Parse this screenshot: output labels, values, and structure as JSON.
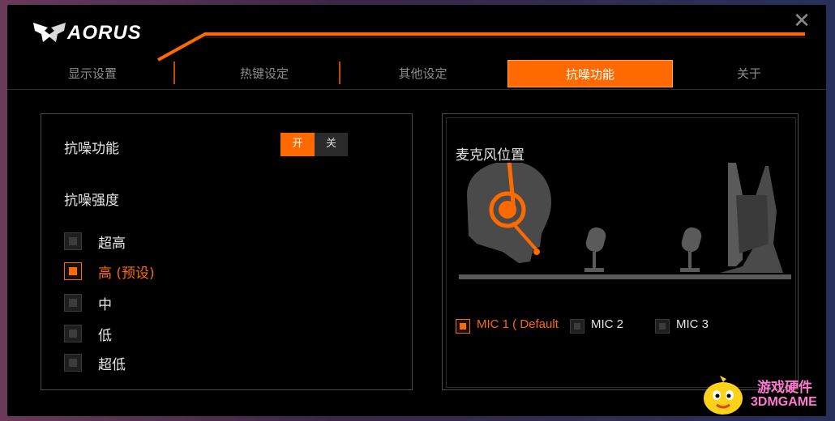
{
  "app": {
    "brand": "AORUS",
    "close_glyph": "✕"
  },
  "tabs": [
    {
      "label": "显示设置",
      "active": false
    },
    {
      "label": "热键设定",
      "active": false
    },
    {
      "label": "其他设定",
      "active": false
    },
    {
      "label": "抗噪功能",
      "active": true
    },
    {
      "label": "关于",
      "active": false
    }
  ],
  "noise_panel": {
    "feature_label": "抗噪功能",
    "toggle_on_label": "开",
    "toggle_off_label": "关",
    "toggle_state": "on",
    "strength_label": "抗噪强度",
    "options": [
      {
        "label": "超高",
        "checked": false
      },
      {
        "label": "高 (预设)",
        "checked": true
      },
      {
        "label": "中",
        "checked": false
      },
      {
        "label": "低",
        "checked": false
      },
      {
        "label": "超低",
        "checked": false
      }
    ]
  },
  "mic_panel": {
    "title": "麦克风位置",
    "options": [
      {
        "label": "MIC 1 ( Default",
        "checked": true
      },
      {
        "label": "MIC 2",
        "checked": false
      },
      {
        "label": "MIC 3",
        "checked": false
      }
    ]
  },
  "watermark": {
    "line1": "游戏硬件",
    "line2": "3DMGAME"
  },
  "colors": {
    "accent": "#ff6a00",
    "background": "#000000",
    "text": "#e6e6e6",
    "muted": "#8c8c8c"
  },
  "icons": [
    "aorus-logo-icon",
    "close-icon",
    "headset-icon",
    "mic-icon",
    "monitor-icon",
    "mascot-icon"
  ]
}
